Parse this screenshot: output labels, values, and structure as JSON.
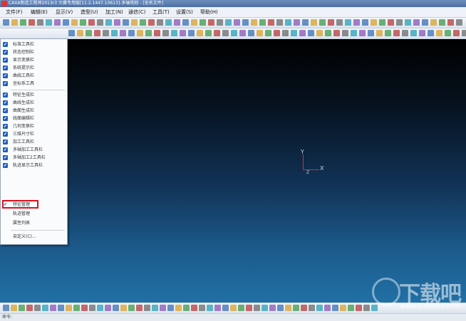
{
  "titlebar": {
    "text": "CAXA制造工程师2013r3 大赛专用版[11.2.1447.10613]-多轴铣削 - [无名文件]"
  },
  "menubar": [
    "文件(F)",
    "编辑(E)",
    "显示(V)",
    "造型(U)",
    "加工(N)",
    "通信(C)",
    "工具(T)",
    "设置(S)",
    "帮助(H)"
  ],
  "context_menu": {
    "items": [
      {
        "label": "标准工具栏",
        "checked": true
      },
      {
        "label": "状态控制栏",
        "checked": true
      },
      {
        "label": "显示变换栏",
        "checked": true
      },
      {
        "label": "系统提示栏",
        "checked": true
      },
      {
        "label": "曲线工具栏",
        "checked": true
      },
      {
        "label": "坐标系工具",
        "checked": true
      },
      {
        "label": "特征生成栏",
        "checked": true
      },
      {
        "label": "曲线生成栏",
        "checked": true
      },
      {
        "label": "曲面生成栏",
        "checked": true
      },
      {
        "label": "线面编辑栏",
        "checked": true
      },
      {
        "label": "几何变换栏",
        "checked": true
      },
      {
        "label": "三维尺寸栏",
        "checked": true
      },
      {
        "label": "加工工具栏",
        "checked": true
      },
      {
        "label": "多轴加工工具栏",
        "checked": true
      },
      {
        "label": "多轴加工2工具栏",
        "checked": true
      },
      {
        "label": "轨迹显示工具栏",
        "checked": true
      },
      {
        "label": "特征管理",
        "checked": true
      },
      {
        "label": "轨迹管理",
        "checked": false
      },
      {
        "label": "属性列表",
        "checked": false
      },
      {
        "label": "自定义(C)...",
        "checked": false
      }
    ],
    "check_glyph": "✔",
    "highlight_color": "#e0101a"
  },
  "axes": {
    "y": "Y",
    "x": "X",
    "z": "Z"
  },
  "status": {
    "text": "命令:"
  },
  "watermark": {
    "text": "下载吧",
    "url": "www.xiazaiba.com"
  }
}
